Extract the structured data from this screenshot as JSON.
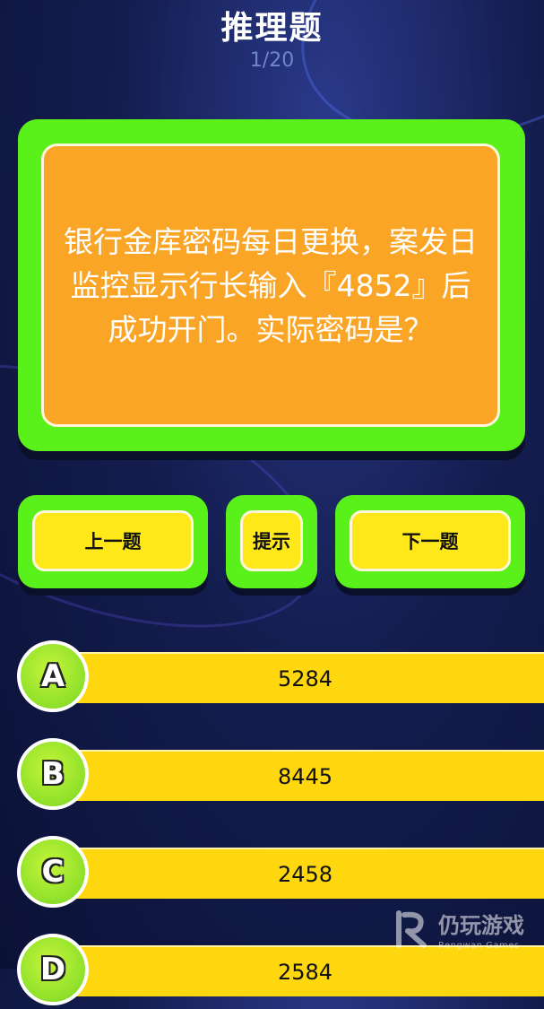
{
  "header": {
    "title": "推理题",
    "progress": "1/20"
  },
  "question": {
    "text": "银行金库密码每日更换，案发日监控显示行长输入『4852』后成功开门。实际密码是？"
  },
  "controls": {
    "prev_label": "上一题",
    "hint_label": "提示",
    "next_label": "下一题"
  },
  "options": [
    {
      "letter": "A",
      "value": "5284"
    },
    {
      "letter": "B",
      "value": "8445"
    },
    {
      "letter": "C",
      "value": "2458"
    },
    {
      "letter": "D",
      "value": "2584"
    }
  ],
  "watermark": {
    "name": "仍玩游戏",
    "sub": "Rengwan Games"
  },
  "colors": {
    "frame_green": "#5af11a",
    "question_orange": "#faa526",
    "button_yellow": "#ffe81a",
    "option_yellow": "#ffd70f",
    "background": "#141d4f"
  }
}
